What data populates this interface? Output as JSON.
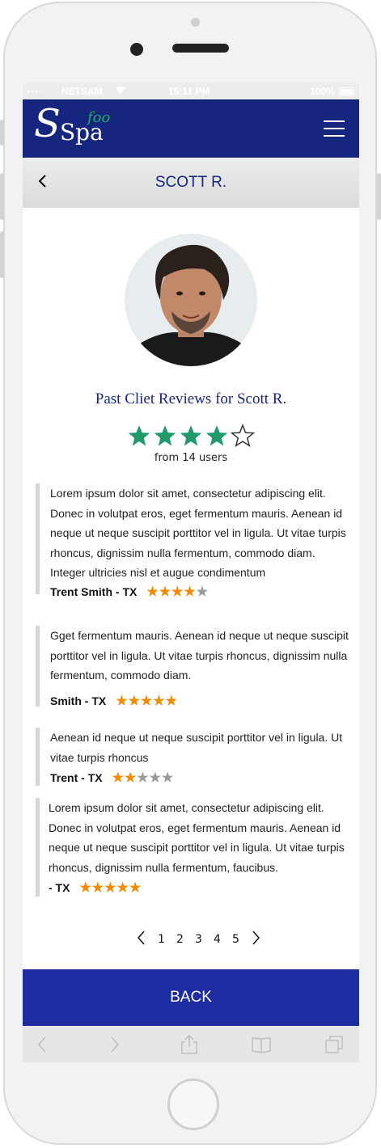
{
  "status_bar": {
    "carrier": "NETSAM",
    "time": "15:11 PM",
    "battery": "100%"
  },
  "navbar": {
    "logo_main": "Spa",
    "logo_accent": "foo"
  },
  "header": {
    "title": "SCOTT R."
  },
  "profile": {
    "reviews_title": "Past Cliet Reviews for Scott R.",
    "rating": 4,
    "rating_max": 5,
    "rating_count": "from 14 users"
  },
  "reviews": [
    {
      "text": "Lorem ipsum dolor sit amet, consectetur adipiscing elit. Donec in volutpat eros, eget fermentum mauris. Aenean id neque ut neque suscipit porttitor vel in ligula. Ut vitae turpis rhoncus, dignissim nulla fermentum, commodo diam. Integer ultricies nisl et augue condimentum",
      "author": "Trent Smith - TX",
      "rating": 4
    },
    {
      "text": "Gget fermentum mauris. Aenean id neque ut neque suscipit porttitor vel in ligula. Ut vitae turpis rhoncus, dignissim nulla fermentum, commodo diam.",
      "author": "Smith - TX",
      "rating": 5
    },
    {
      "text": "Aenean id neque ut neque suscipit porttitor vel in ligula. Ut vitae turpis rhoncus",
      "author": "Trent - TX",
      "rating": 2
    },
    {
      "text": "Lorem ipsum dolor sit amet, consectetur adipiscing elit. Donec in volutpat eros, eget fermentum mauris. Aenean id neque ut neque suscipit porttitor vel in ligula. Ut vitae turpis rhoncus, dignissim nulla fermentum, faucibus.",
      "author": "- TX",
      "rating": 5
    }
  ],
  "pagination": {
    "pages": [
      "1",
      "2",
      "3",
      "4",
      "5"
    ]
  },
  "back_button": {
    "label": "BACK"
  },
  "colors": {
    "brand": "#16257e",
    "button": "#1d2ca0",
    "star_green": "#1f9a68",
    "star_orange": "#f38b00",
    "star_gray": "#9a9a9a"
  },
  "icons": {
    "menu": "hamburger-menu-icon",
    "back": "chevron-left-icon",
    "prev": "chevron-left-icon",
    "next": "chevron-right-icon",
    "share": "share-icon",
    "bookmarks": "book-icon",
    "tabs": "tabs-icon"
  }
}
